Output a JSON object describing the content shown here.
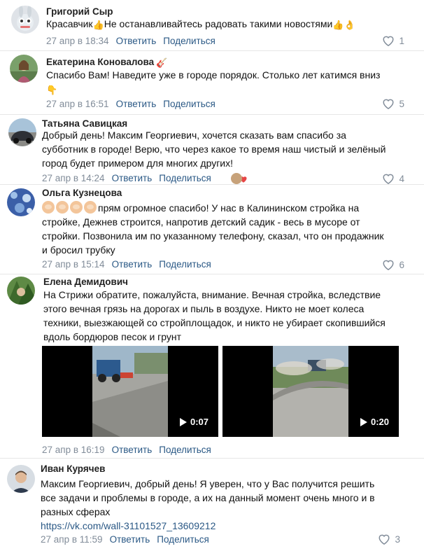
{
  "comments": [
    {
      "author": "Григорий Сыр",
      "text_lines": [
        "Красавчик",
        "Не останавливайтесь радовать такими новостями"
      ],
      "date": "27 апр в 18:34",
      "reply": "Ответить",
      "share": "Поделиться",
      "likes": "1"
    },
    {
      "author": "Екатерина Коновалова",
      "text_lines": [
        "Спасибо Вам! Наведите уже в городе порядок. Столько лет катимся вниз"
      ],
      "date": "27 апр в 16:51",
      "reply": "Ответить",
      "share": "Поделиться",
      "likes": "5"
    },
    {
      "author": "Татьяна Савицкая",
      "text_lines": [
        "Добрый день! Максим Георгиевич, хочется сказать вам спасибо за",
        "субботник в городе! Верю, что через какое то время наш чистый и зелёный",
        "город будет примером для многих других!"
      ],
      "date": "27 апр в 14:24",
      "reply": "Ответить",
      "share": "Поделиться",
      "likes": "4"
    },
    {
      "author": "Ольга Кузнецова",
      "text_lines": [
        "прям огромное спасибо! У нас в Калининском стройка на",
        "стройке, Дежнев строится, напротив детский садик - весь в мусоре от",
        "стройки. Позвонила им по указанному телефону, сказал, что он продажник",
        "и бросил трубку"
      ],
      "date": "27 апр в 15:14",
      "reply": "Ответить",
      "share": "Поделиться",
      "likes": "6"
    },
    {
      "author": "Елена Демидович",
      "text_lines": [
        "На Стрижи обратите, пожалуйста, внимание. Вечная стройка, вследствие",
        "этого вечная грязь на дорогах и пыль в воздухе. Никто не моет колеса",
        "техники, выезжающей со стройплощадок, и никто не убирает скопившийся",
        "вдоль бордюров песок и грунт"
      ],
      "videos": [
        {
          "duration": "0:07"
        },
        {
          "duration": "0:20"
        }
      ],
      "date": "27 апр в 16:19",
      "reply": "Ответить",
      "share": "Поделиться"
    },
    {
      "author": "Иван Курячев",
      "text_lines": [
        "Максим Георгиевич, добрый день! Я уверен, что у Вас получится решить",
        "все задачи и проблемы в городе, а их на данный момент очень много и в",
        "разных сферах"
      ],
      "link": "https://vk.com/wall-31101527_13609212",
      "date": "27 апр в 11:59",
      "reply": "Ответить",
      "share": "Поделиться",
      "likes": "3"
    }
  ],
  "icons": {
    "like": "heart-outline-icon",
    "play": "play-icon"
  },
  "colors": {
    "accent": "#2a5885",
    "meta": "#818c99",
    "divider": "#e6e6e6"
  }
}
